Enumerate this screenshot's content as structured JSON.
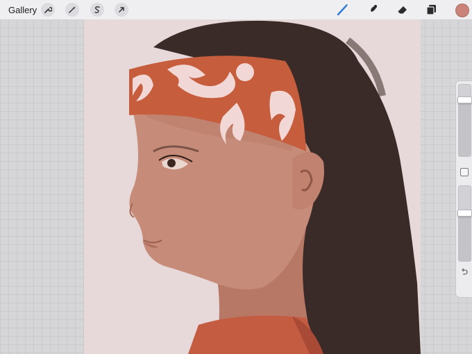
{
  "topbar": {
    "gallery_label": "Gallery",
    "left_tools": [
      {
        "name": "actions",
        "icon": "wrench-icon"
      },
      {
        "name": "adjustments",
        "icon": "magic-wand-icon"
      },
      {
        "name": "selection",
        "icon": "selection-s-icon"
      },
      {
        "name": "transform",
        "icon": "arrow-cursor-icon"
      }
    ],
    "right_tools": [
      {
        "name": "brush",
        "icon": "brush-icon",
        "active": true
      },
      {
        "name": "smudge",
        "icon": "smudge-icon"
      },
      {
        "name": "eraser",
        "icon": "eraser-icon"
      },
      {
        "name": "layers",
        "icon": "layers-icon"
      }
    ],
    "current_color": "#c98378"
  },
  "colors": {
    "accent_active": "#2f7ad9",
    "canvas_background": "#e7d8d9",
    "hair": "#3a2a28",
    "headband": "#c65d3c",
    "headband_pattern": "#f1d8d6",
    "skin": "#c78c79",
    "shirt": "#c45c42"
  },
  "sidebar": {
    "brush_size_level": 0.78,
    "opacity_level": 0.63,
    "modify_button_icon": "square-icon",
    "undo_icon": "undo-icon"
  }
}
